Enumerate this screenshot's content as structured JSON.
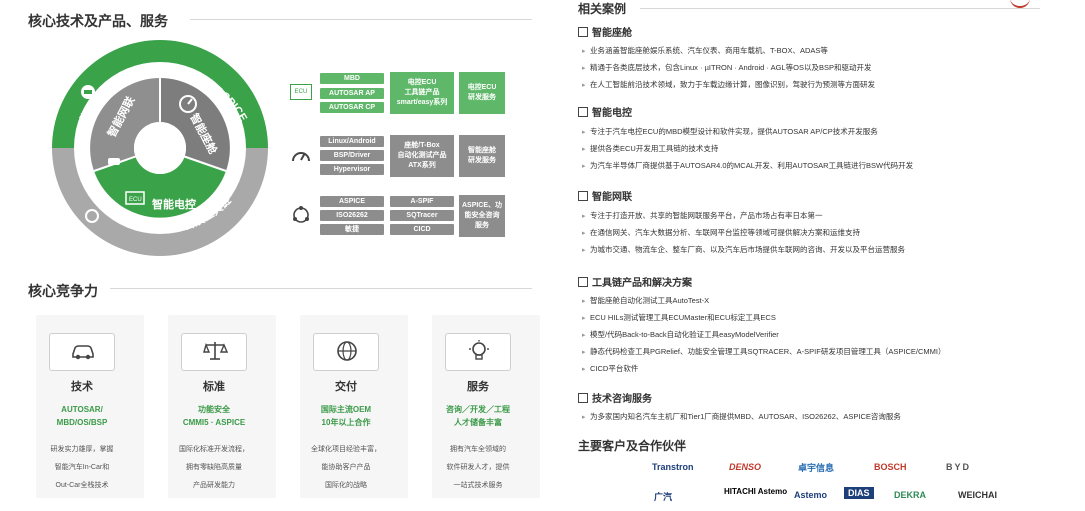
{
  "left": {
    "core_title": "核心技术及产品、服务",
    "ring": {
      "outer_green_1": "咨询服务",
      "outer_green_2": "功能安全·敏捷·ASPICE",
      "outer_grey": "组织级研发管理平台及工具链",
      "inner_1": "智能网联",
      "inner_2": "智能座舱",
      "inner_3": "智能电控",
      "ecu_icon": "ECU"
    },
    "rows": [
      {
        "pills": [
          "MBD",
          "AUTOSAR AP",
          "AUTOSAR CP"
        ],
        "mid": "电控ECU\n工具链产品\nsmart/easy系列",
        "right": "电控ECU\n研发服务",
        "color": "green"
      },
      {
        "pills": [
          "Linux/Android",
          "BSP/Driver",
          "Hypervisor"
        ],
        "mid": "座舱/T-Box\n自动化测试产品\nATX系列",
        "right": "智能座舱\n研发服务",
        "color": "grey"
      },
      {
        "pills": [
          "ASPICE",
          "ISO26262",
          "敏捷"
        ],
        "pills2": [
          "A-SPIF",
          "SQTracer",
          "CICD"
        ],
        "right": "ASPICE、功\n能安全咨询\n服务",
        "color": "grey"
      }
    ],
    "competence_title": "核心竞争力",
    "cards": [
      {
        "icon": "car-icon",
        "title": "技术",
        "green": [
          "AUTOSAR/",
          "MBD/OS/BSP"
        ],
        "desc": [
          "研发实力雄厚，掌握",
          "智能汽车In-Car和",
          "Out-Car全栈技术"
        ]
      },
      {
        "icon": "scale-icon",
        "title": "标准",
        "green": [
          "功能安全",
          "CMMI5 · ASPICE"
        ],
        "desc": [
          "国际化标准开发流程，",
          "拥有零缺陷高质量",
          "产品研发能力"
        ]
      },
      {
        "icon": "globe-icon",
        "title": "交付",
        "green": [
          "国际主流OEM",
          "10年以上合作"
        ],
        "desc": [
          "全球化项目经验丰富，",
          "能协助客户产品",
          "国际化的战略"
        ]
      },
      {
        "icon": "lightbulb-icon",
        "title": "服务",
        "green": [
          "咨询／开发／工程",
          "人才储备丰富"
        ],
        "desc": [
          "拥有汽车全领域的",
          "软件研发人才，提供",
          "一站式技术服务"
        ]
      }
    ]
  },
  "right": {
    "cases_title": "相关案例",
    "sections": [
      {
        "head": "智能座舱",
        "items": [
          "业务涵盖智能座舱娱乐系统、汽车仪表、商用车载机、T-BOX、ADAS等",
          "精通于各类底层技术，包含Linux · µITRON · Android · AGL等OS以及BSP和驱动开发",
          "在人工智能前沿技术领域，致力于车载边缘计算，图像识别，驾驶行为预测等方面研发"
        ]
      },
      {
        "head": "智能电控",
        "items": [
          "专注于汽车电控ECU的MBD模型设计和软件实现，提供AUTOSAR AP/CP技术开发服务",
          "提供各类ECU开发用工具链的技术支持",
          "为汽车半导体厂商提供基于AUTOSAR4.0的MCAL开发、利用AUTOSAR工具链进行BSW代码开发"
        ]
      },
      {
        "head": "智能网联",
        "items": [
          "专注于打造开放、共享的智能网联服务平台，产品市场占有率日本第一",
          "在通信网关、汽车大数据分析、车联网平台监控等领域可提供解决方案和运维支持",
          "为城市交通、物流车企、整车厂商、以及汽车后市场提供车联网的咨询、开发以及平台运营服务"
        ]
      },
      {
        "head": "工具链产品和解决方案",
        "items": [
          "智能座舱自动化测试工具AutoTest-X",
          "ECU HILs测试管理工具ECUMaster和ECU标定工具ECS",
          "模型/代码Back-to-Back自动化验证工具easyModelVerifier",
          "静态代码检查工具PGRelief、功能安全管理工具SQTRACER、A-SPIF研发项目管理工具（ASPICE/CMMI）",
          "CICD平台软件"
        ]
      },
      {
        "head": "技术咨询服务",
        "items": [
          "为多家国内知名汽车主机厂和Tier1厂商提供MBD、AUTOSAR、ISO26262、ASPICE咨询服务"
        ]
      }
    ],
    "clients_title": "主要客户及合作伙伴",
    "logos_row1": [
      "Transtron",
      "DENSO",
      "卓宇信息",
      "BOSCH",
      "BYD"
    ],
    "logos_row2": [
      "广汽",
      "HITACHI Astemo",
      "Astemo",
      "DIAS",
      "DEKRA",
      "WEICHAI"
    ],
    "colors": {
      "green": "#3a9a48",
      "grey": "#8d8d8d",
      "accent_red": "#c0392b"
    }
  }
}
